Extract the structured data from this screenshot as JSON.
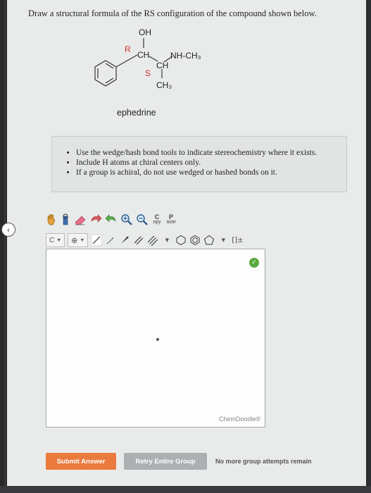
{
  "question": {
    "prompt": "Draw a structural formula of the RS configuration of the compound shown below."
  },
  "molecule": {
    "labels": {
      "oh": "OH",
      "r": "R",
      "ch1": "CH",
      "nh_ch3": "NH-CH₃",
      "ch2": "CH",
      "s": "S",
      "ch3": "CH₃"
    },
    "name": "ephedrine"
  },
  "hints": {
    "items": [
      "Use the wedge/hash bond tools to indicate stereochemistry where it exists.",
      "Include H atoms at chiral centers only.",
      "If a group is achiral, do not use wedged or hashed bonds on it."
    ]
  },
  "toolbar": {
    "copy_top": "C",
    "copy_bottom": "opy",
    "paste_top": "P",
    "paste_bottom": "aste",
    "element_value": "C",
    "charge_symbol": "⊕",
    "brackets": "[]±"
  },
  "canvas": {
    "brand": "ChemDoodle®"
  },
  "actions": {
    "submit": "Submit Answer",
    "retry": "Retry Entire Group",
    "status": "No more group attempts remain"
  },
  "colors": {
    "submit": "#ea7a3e",
    "retry": "#acb0b3",
    "valid": "#5aaa3d",
    "stereo_label": "#d03030"
  }
}
